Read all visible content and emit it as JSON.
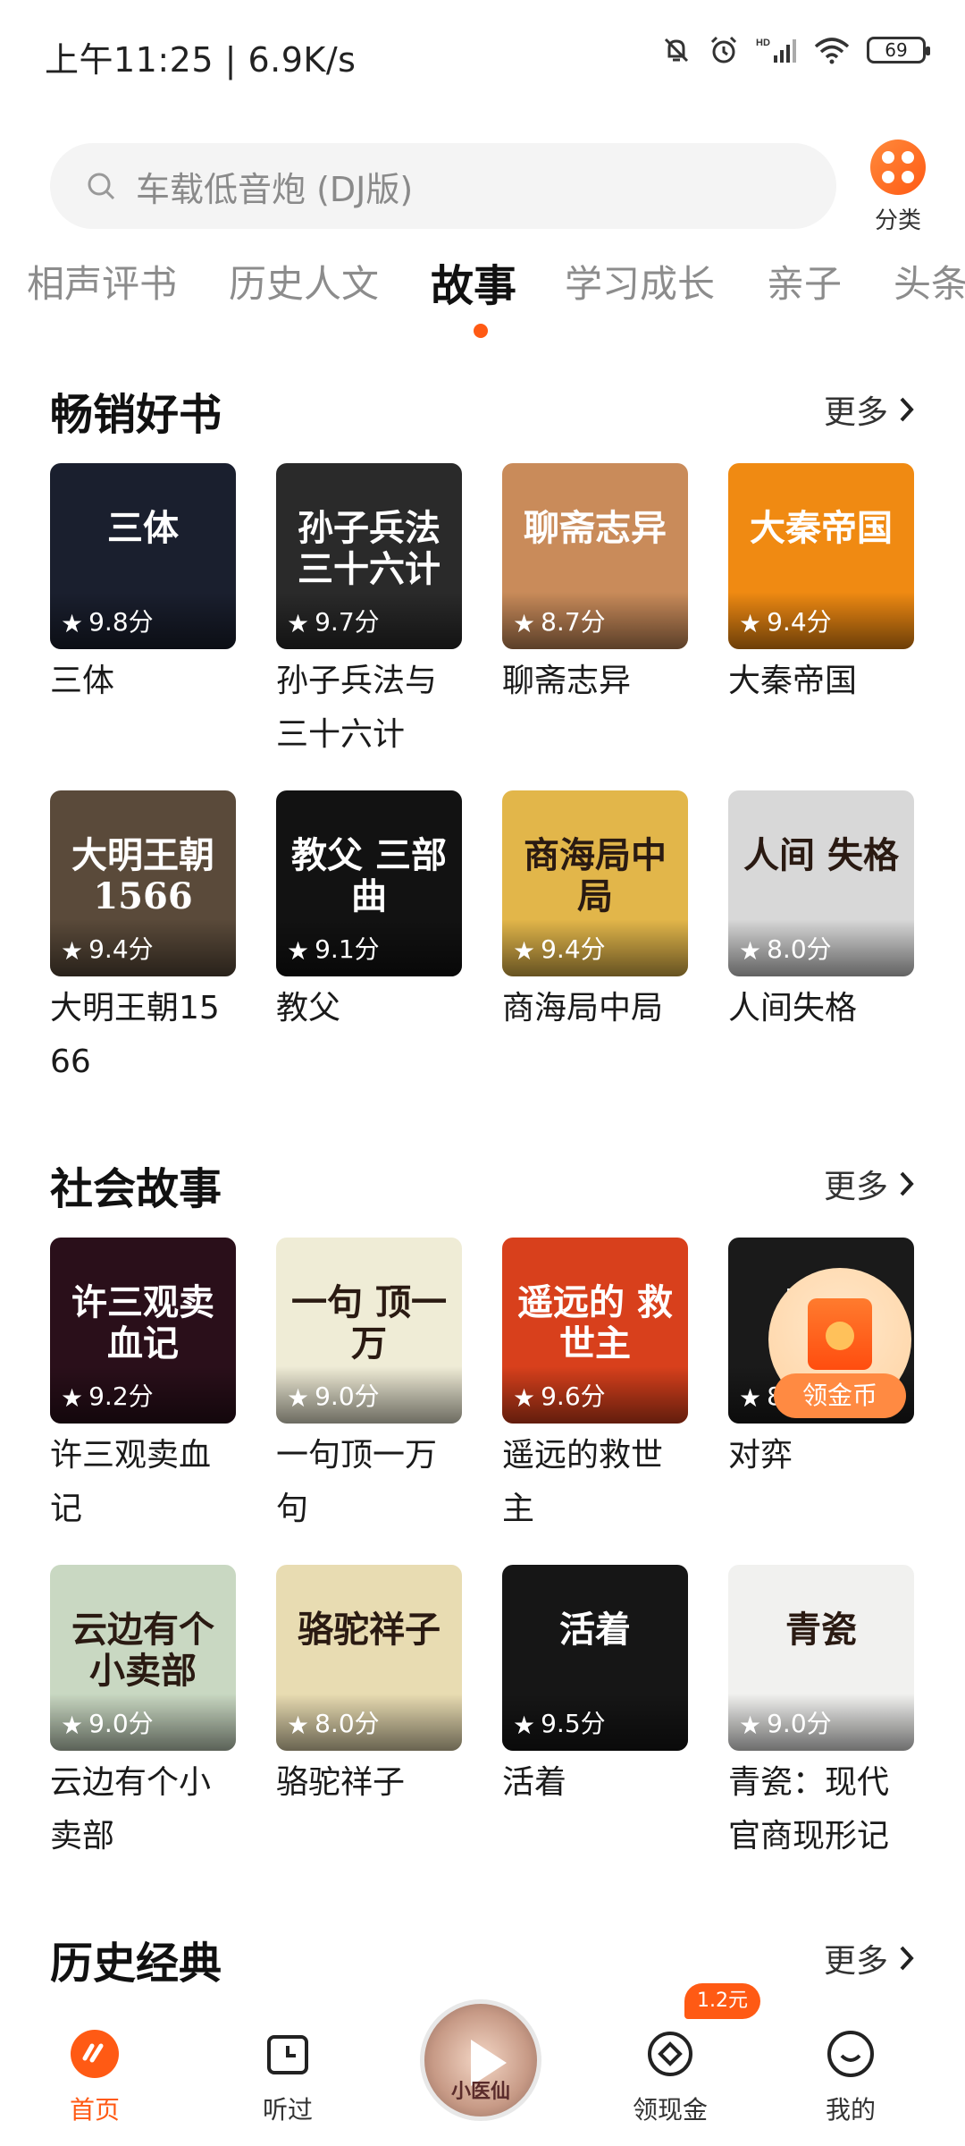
{
  "status": {
    "time": "上午11:25 | 6.9K/s",
    "battery": "69"
  },
  "search": {
    "placeholder": "车载低音炮 (DJ版)",
    "category_label": "分类"
  },
  "tabs": [
    "相声评书",
    "历史人文",
    "故事",
    "学习成长",
    "亲子",
    "头条"
  ],
  "active_tab": "故事",
  "sections": [
    {
      "title": "畅销好书",
      "more": "更多",
      "books": [
        {
          "title": "三体",
          "rating": "9.8分",
          "cover_text": "三体",
          "cover_color": "#1a1f2e"
        },
        {
          "title": "孙子兵法与三十六计",
          "rating": "9.7分",
          "cover_text": "孙子兵法 三十六计",
          "cover_color": "#2a2a2a"
        },
        {
          "title": "聊斋志异",
          "rating": "8.7分",
          "cover_text": "聊斋志异",
          "cover_color": "#c98b5a"
        },
        {
          "title": "大秦帝国",
          "rating": "9.4分",
          "cover_text": "大秦帝国",
          "cover_color": "#f08a12"
        },
        {
          "title": "大明王朝1566",
          "rating": "9.4分",
          "cover_text": "大明王朝 1566",
          "cover_color": "#5a4a3a"
        },
        {
          "title": "教父",
          "rating": "9.1分",
          "cover_text": "教父 三部曲",
          "cover_color": "#121212"
        },
        {
          "title": "商海局中局",
          "rating": "9.4分",
          "cover_text": "商海局中局",
          "cover_color": "#e2b64a"
        },
        {
          "title": "人间失格",
          "rating": "8.0分",
          "cover_text": "人间 失格",
          "cover_color": "#d8d8d8"
        }
      ]
    },
    {
      "title": "社会故事",
      "more": "更多",
      "books": [
        {
          "title": "许三观卖血记",
          "rating": "9.2分",
          "cover_text": "许三观卖血记",
          "cover_color": "#2a0f1a"
        },
        {
          "title": "一句顶一万句",
          "rating": "9.0分",
          "cover_text": "一句 顶一万",
          "cover_color": "#efecd6"
        },
        {
          "title": "遥远的救世主",
          "rating": "9.6分",
          "cover_text": "遥远的 救世主",
          "cover_color": "#d8401c"
        },
        {
          "title": "对弈",
          "rating": "8.2分",
          "cover_text": "对弈",
          "cover_color": "#1a1a1a"
        },
        {
          "title": "云边有个小卖部",
          "rating": "9.0分",
          "cover_text": "云边有个 小卖部",
          "cover_color": "#c9d8c2"
        },
        {
          "title": "骆驼祥子",
          "rating": "8.0分",
          "cover_text": "骆驼祥子",
          "cover_color": "#e8dcb2"
        },
        {
          "title": "活着",
          "rating": "9.5分",
          "cover_text": "活着",
          "cover_color": "#161616"
        },
        {
          "title": "青瓷：现代官商现形记",
          "rating": "9.0分",
          "cover_text": "青瓷",
          "cover_color": "#f1f1ef"
        }
      ]
    },
    {
      "title": "历史经典",
      "more": "更多"
    }
  ],
  "float_coin": {
    "label": "领金币"
  },
  "bottom_nav": {
    "home": "首页",
    "history": "听过",
    "now_playing_text": "小医仙",
    "cash": "领现金",
    "cash_badge": "1.2元",
    "mine": "我的"
  },
  "colors": {
    "accent": "#ff5a14"
  }
}
